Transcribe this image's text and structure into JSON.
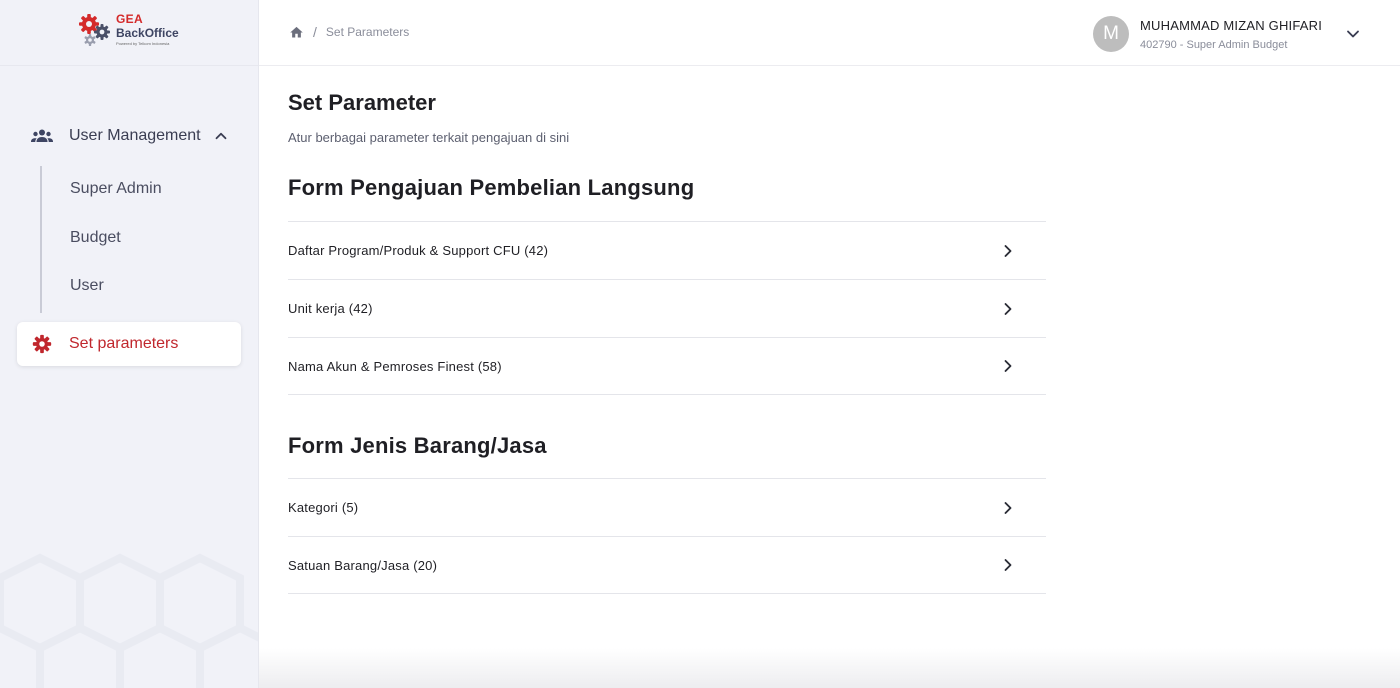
{
  "logo": {
    "brand_top": "GEA",
    "brand_bottom": "BackOffice",
    "tagline": "Powered by Telkom Indonesia"
  },
  "sidebar": {
    "group_label": "User Management",
    "sub_items": [
      "Super Admin",
      "Budget",
      "User"
    ],
    "active_item": "Set parameters"
  },
  "header": {
    "breadcrumb_current": "Set Parameters",
    "breadcrumb_sep": "/",
    "user_initial": "M",
    "user_name": "MUHAMMAD MIZAN GHIFARI",
    "user_role": "402790 - Super Admin Budget"
  },
  "main": {
    "title": "Set Parameter",
    "subtitle": "Atur berbagai parameter terkait pengajuan di sini",
    "sections": [
      {
        "title": "Form Pengajuan Pembelian Langsung",
        "rows": [
          "Daftar Program/Produk & Support CFU (42)",
          "Unit kerja (42)",
          "Nama Akun & Pemroses Finest (58)"
        ]
      },
      {
        "title": "Form Jenis Barang/Jasa",
        "rows": [
          "Kategori (5)",
          "Satuan Barang/Jasa (20)"
        ]
      }
    ]
  },
  "colors": {
    "accent": "#c0272d",
    "sidebar_bg": "#f1f2f8"
  }
}
